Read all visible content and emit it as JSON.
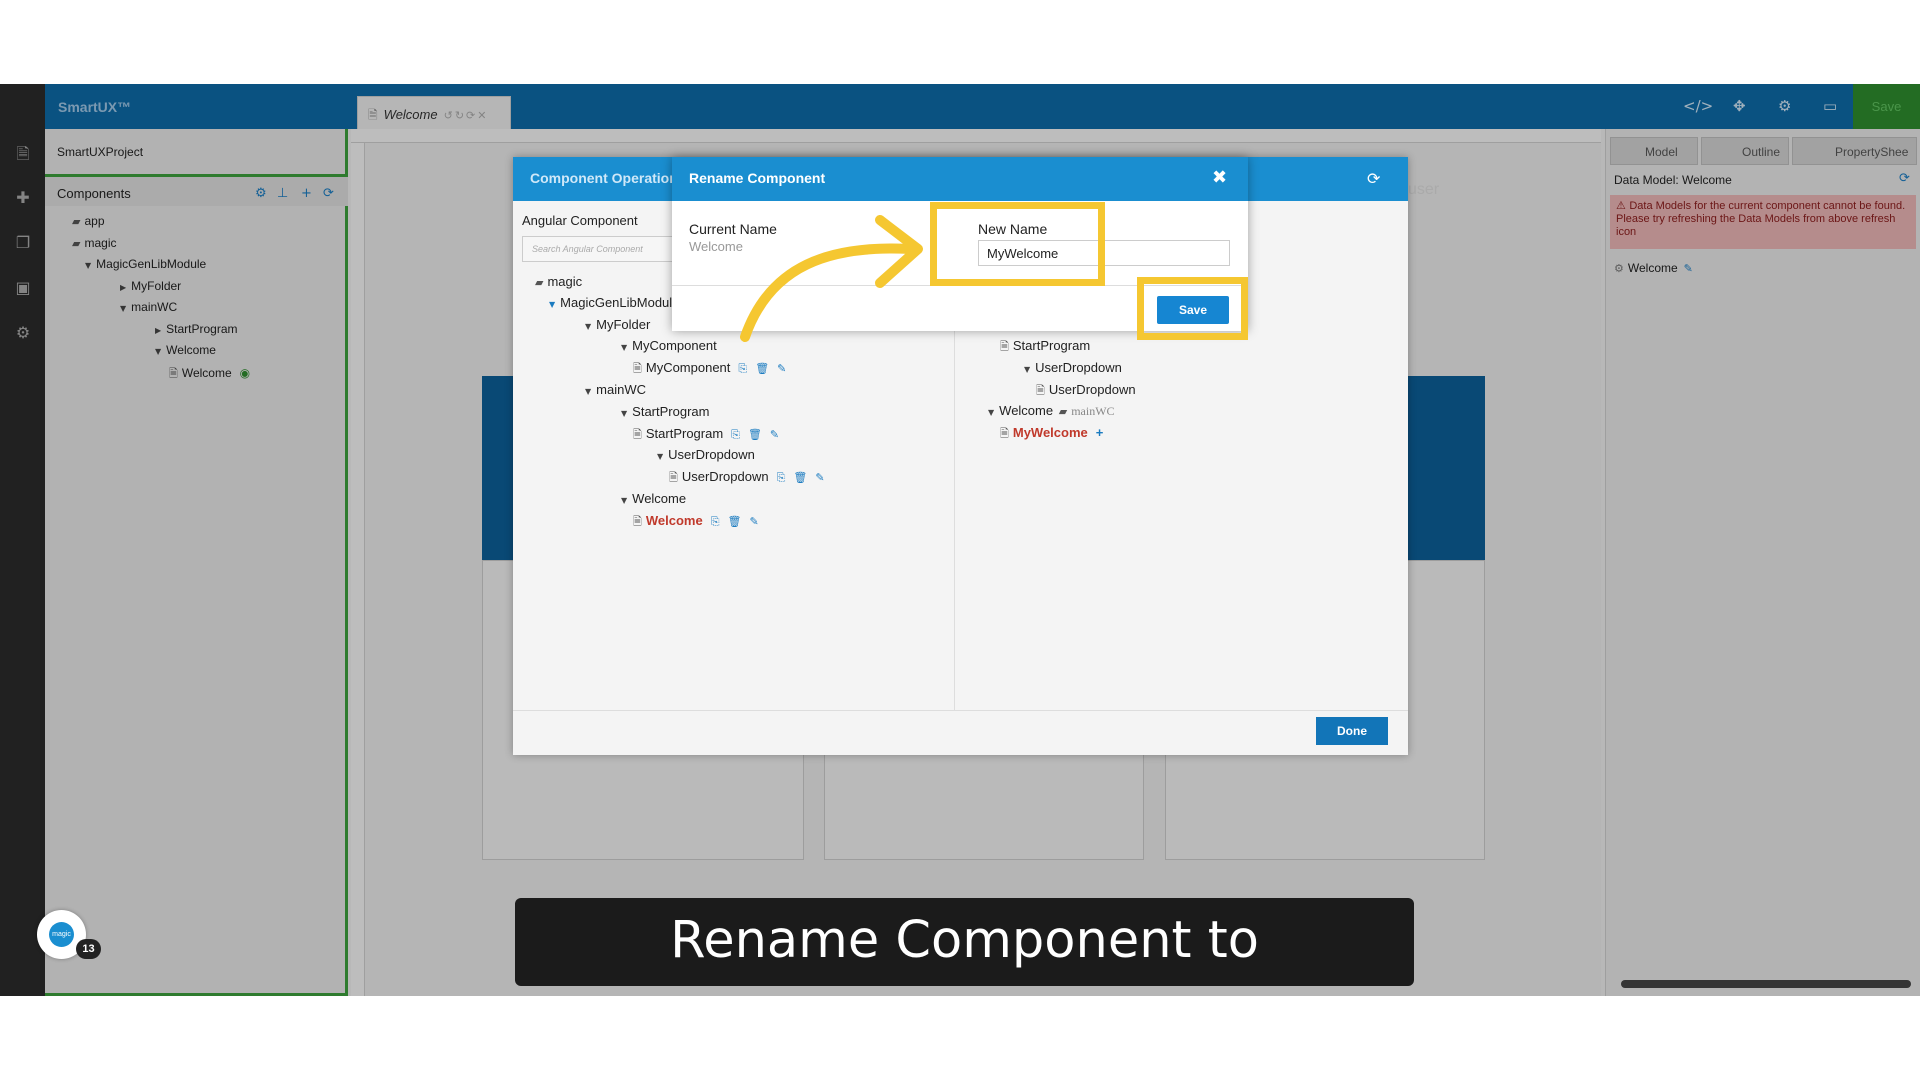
{
  "app": {
    "title": "SmartUX™",
    "editor_tab": "Welcome",
    "top_save": "Save"
  },
  "left_panel": {
    "project": "SmartUXProject",
    "components_label": "Components",
    "tree": [
      "app",
      "magic",
      "MagicGenLibModule",
      "MyFolder",
      "mainWC",
      "StartProgram",
      "Welcome",
      "Welcome"
    ]
  },
  "background": {
    "user_text": "user"
  },
  "right_panel": {
    "tabs": [
      "Model",
      "Outline",
      "PropertyShee"
    ],
    "data_model_title": "Data Model: Welcome",
    "warning": "Data Models for the current component cannot be found. Please try refreshing the Data Models from above refresh icon",
    "model_item": "Welcome"
  },
  "ops_dialog": {
    "title": "Component Operations",
    "angular_label": "Angular Component",
    "search_placeholder": "Search Angular Component",
    "tree": [
      "magic",
      "MagicGenLibModule",
      "MyFolder",
      "MyComponent",
      "MyComponent",
      "mainWC",
      "StartProgram",
      "StartProgram",
      "UserDropdown",
      "UserDropdown",
      "Welcome",
      "Welcome"
    ],
    "right_tree": [
      "StartProgram",
      "UserDropdown",
      "UserDropdown",
      "Welcome",
      "mainWC",
      "MyWelcome"
    ],
    "done_label": "Done"
  },
  "rename_dialog": {
    "title": "Rename Component",
    "current_label": "Current Name",
    "current_value": "Welcome",
    "new_label": "New Name",
    "new_value": "MyWelcome",
    "save_label": "Save"
  },
  "caption": "Rename Component to MyWelcome",
  "badge": {
    "logo": "magic",
    "count": "13"
  },
  "colors": {
    "header_blue": "#1a8ed0",
    "highlight": "#f5c731",
    "accent_green": "#3b9e3b"
  }
}
